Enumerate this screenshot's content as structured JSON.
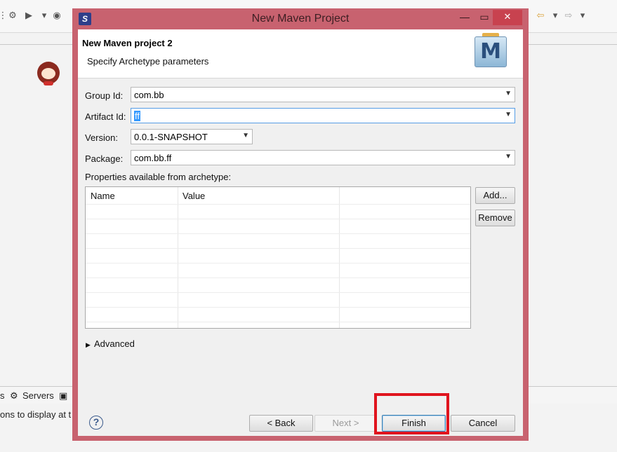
{
  "dialog": {
    "title": "New Maven Project",
    "header_title": "New Maven project 2",
    "header_subtitle": "Specify Archetype parameters",
    "logo_letter": "M"
  },
  "form": {
    "group_id_label": "Group Id:",
    "group_id_value": "com.bb",
    "artifact_id_label": "Artifact Id:",
    "artifact_id_value": "ff",
    "version_label": "Version:",
    "version_value": "0.0.1-SNAPSHOT",
    "package_label": "Package:",
    "package_value": "com.bb.ff",
    "properties_label": "Properties available from archetype:"
  },
  "properties_table": {
    "columns": [
      "Name",
      "Value",
      ""
    ],
    "rows": []
  },
  "buttons": {
    "add": "Add...",
    "remove": "Remove",
    "back": "< Back",
    "next": "Next >",
    "finish": "Finish",
    "cancel": "Cancel"
  },
  "advanced_label": "Advanced",
  "background": {
    "servers_tab": "Servers",
    "partial_tab": "s",
    "panel_text": "ons to display at t"
  },
  "colors": {
    "dialog_frame": "#c8626f",
    "close_button": "#c8424f",
    "highlight_box": "#e0141e"
  },
  "icons": [
    "app-icon",
    "minimize-icon",
    "maximize-icon",
    "close-icon",
    "maven-logo-icon",
    "help-icon",
    "dropdown-arrow-icon",
    "expand-triangle-icon"
  ]
}
